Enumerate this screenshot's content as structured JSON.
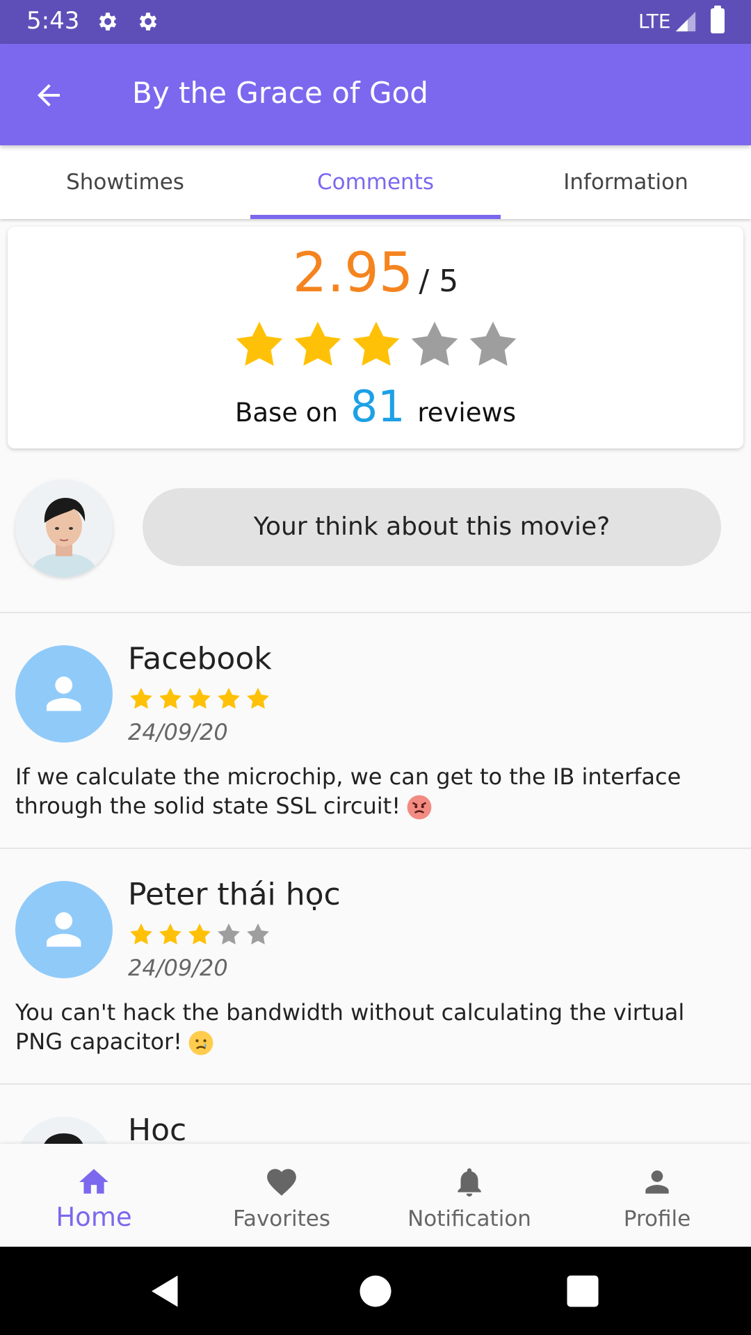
{
  "status_bar": {
    "time": "5:43",
    "network": "LTE"
  },
  "app_bar": {
    "title": "By the Grace of God"
  },
  "tabs": [
    {
      "label": "Showtimes"
    },
    {
      "label": "Comments"
    },
    {
      "label": "Information"
    }
  ],
  "rating": {
    "score": "2.95",
    "max": "/ 5",
    "stars": 3,
    "reviews_prefix": "Base on",
    "reviews_count": "81",
    "reviews_suffix": "reviews"
  },
  "compose": {
    "placeholder": "Your think about this movie?"
  },
  "comments": [
    {
      "name": "Facebook",
      "stars": 5,
      "date": "24/09/20",
      "text": "If we calculate the microchip, we can get to the IB interface through the solid state SSL circuit!",
      "emoji": "angry-face"
    },
    {
      "name": "Peter thái học",
      "stars": 3,
      "date": "24/09/20",
      "text": "You can't hack the bandwidth without calculating the virtual PNG capacitor!",
      "emoji": "crying-face"
    },
    {
      "name": "Hoc"
    }
  ],
  "bottom_nav": [
    {
      "label": "Home",
      "icon": "home-icon",
      "active": true
    },
    {
      "label": "Favorites",
      "icon": "heart-icon"
    },
    {
      "label": "Notification",
      "icon": "bell-icon"
    },
    {
      "label": "Profile",
      "icon": "person-icon"
    }
  ],
  "colors": {
    "primary": "#7b68ee",
    "status_bar": "#5e4fb8",
    "score": "#f5841f",
    "count": "#1ea0e6",
    "star_on": "#ffc107",
    "star_off": "#9e9e9e"
  }
}
